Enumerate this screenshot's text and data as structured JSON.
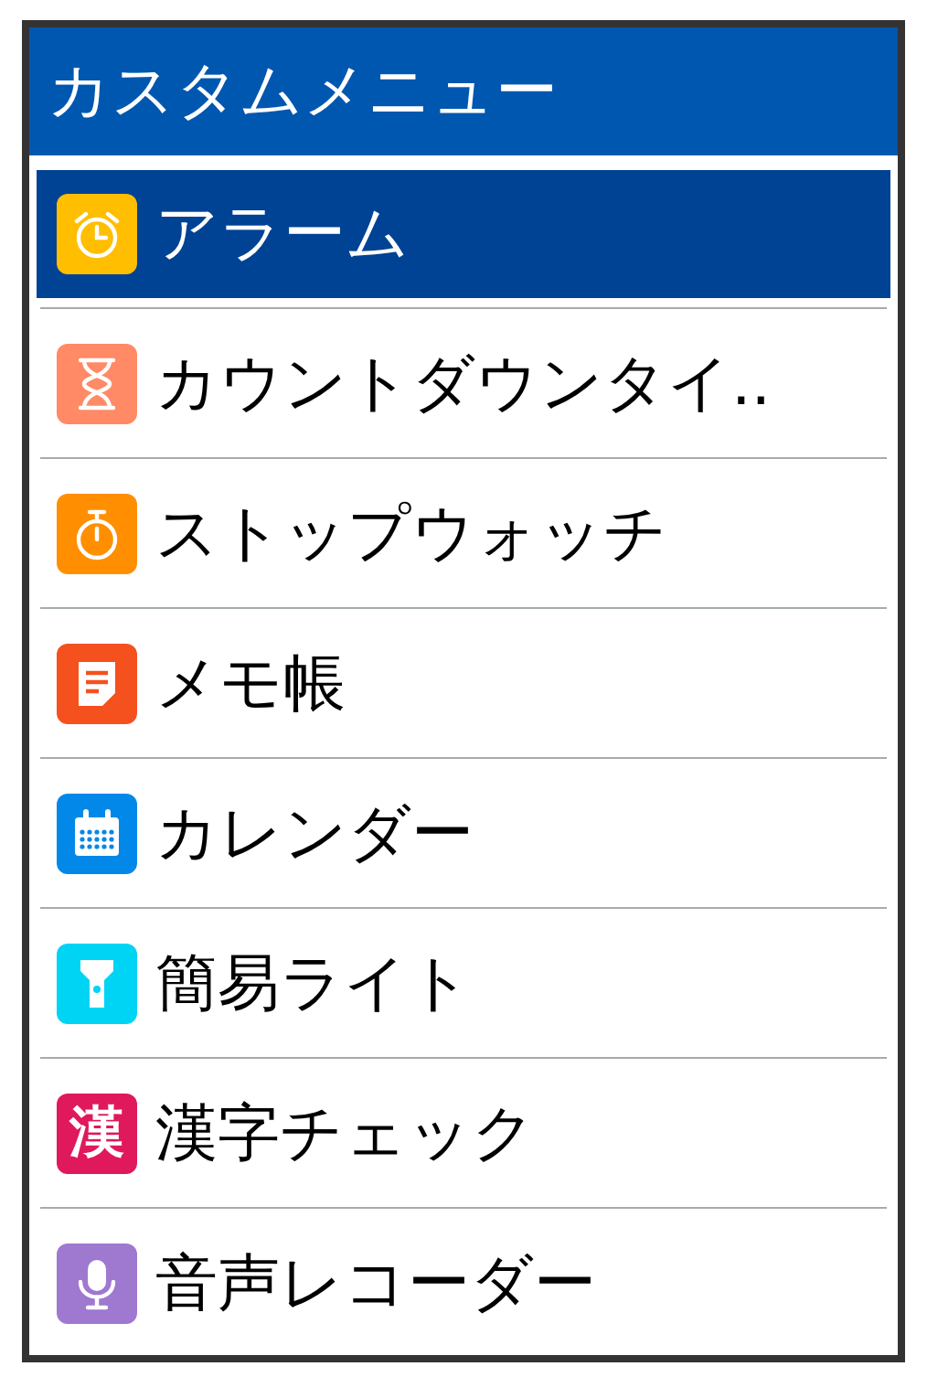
{
  "header": {
    "title": "カスタムメニュー"
  },
  "menu": [
    {
      "label": "アラーム",
      "kind": "alarm",
      "selected": true
    },
    {
      "label": "カウントダウンタイ..",
      "kind": "hourglass",
      "selected": false
    },
    {
      "label": "ストップウォッチ",
      "kind": "stopwatch",
      "selected": false
    },
    {
      "label": "メモ帳",
      "kind": "memo",
      "selected": false
    },
    {
      "label": "カレンダー",
      "kind": "calendar",
      "selected": false
    },
    {
      "label": "簡易ライト",
      "kind": "light",
      "selected": false
    },
    {
      "label": "漢字チェック",
      "kind": "kanji",
      "icon_label": "漢",
      "selected": false
    },
    {
      "label": "音声レコーダー",
      "kind": "mic",
      "selected": false
    }
  ]
}
